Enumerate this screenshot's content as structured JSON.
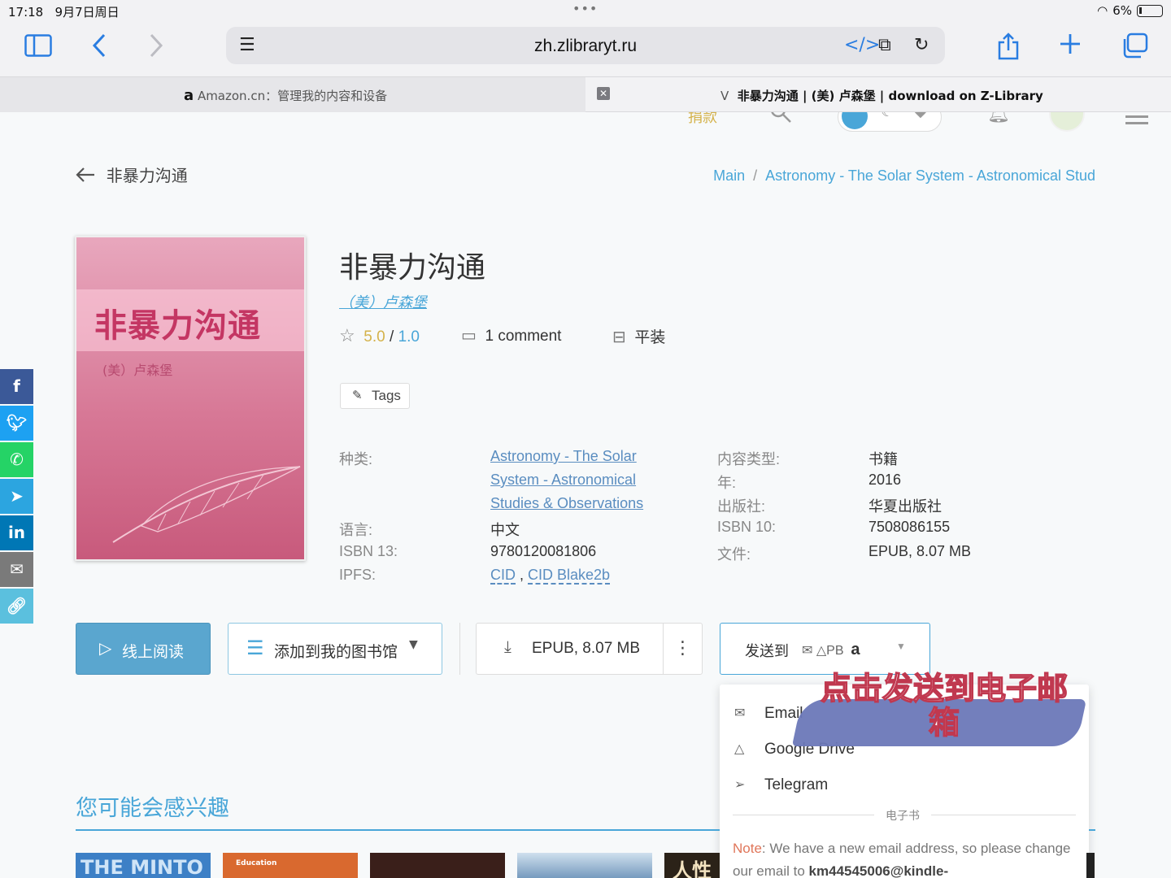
{
  "status": {
    "time": "17:18",
    "date": "9月7日周日",
    "battery": "6%"
  },
  "browser": {
    "url": "zh.zlibraryt.ru",
    "tabs": [
      {
        "prefix": "a",
        "label": "Amazon.cn：管理我的内容和设备"
      },
      {
        "prefix": "V",
        "label": "非暴力沟通 | (美) 卢森堡 | download on Z-Library"
      }
    ]
  },
  "header": {
    "donate": "捐款"
  },
  "page": {
    "back_label": "非暴力沟通",
    "breadcrumb": [
      "Main",
      "Astronomy - The Solar System - Astronomical Stud"
    ]
  },
  "book": {
    "cover_title": "非暴力沟通",
    "cover_author": "(美）卢森堡",
    "title": "非暴力沟通",
    "author": "（美）卢森堡",
    "rating": "5.0",
    "rating_max": "1.0",
    "rating_sep": " / ",
    "comments": "1 comment",
    "binding": "平装",
    "tags_label": "Tags"
  },
  "properties": {
    "category_label": "种类:",
    "category_lines": [
      "Astronomy - The Solar",
      "System - Astronomical",
      "Studies & Observations"
    ],
    "language_label": "语言:",
    "language": "中文",
    "isbn13_label": "ISBN 13:",
    "isbn13": "9780120081806",
    "ipfs_label": "IPFS:",
    "ipfs_cid": "CID",
    "ipfs_sep": " , ",
    "ipfs_blake": "CID Blake2b",
    "content_type_label": "内容类型:",
    "content_type": "书籍",
    "year_label": "年:",
    "year": "2016",
    "publisher_label": "出版社:",
    "publisher": "华夏出版社",
    "isbn10_label": "ISBN 10:",
    "isbn10": "7508086155",
    "file_label": "文件:",
    "file": "EPUB, 8.07 MB"
  },
  "actions": {
    "read_online": "线上阅读",
    "add_library": "添加到我的图书馆",
    "download": "EPUB, 8.07 MB",
    "send_to": "发送到",
    "send_formats": "PB"
  },
  "send_menu": {
    "items": [
      "Email",
      "Google Drive",
      "Telegram"
    ],
    "section": "电子书",
    "note_prefix": "Note",
    "note_text": ": We have a new email address, so please change our email to ",
    "note_email": "km44545006@kindle-"
  },
  "annotation": "点击发送到电子邮箱",
  "recommendations": {
    "title": "您可能会感兴趣",
    "books": [
      "THE MINTO",
      "Education",
      "",
      "",
      "人性的"
    ]
  },
  "colors": {
    "accent": "#49a6d8",
    "rating": "#d4b24a",
    "note": "#e0765a"
  }
}
